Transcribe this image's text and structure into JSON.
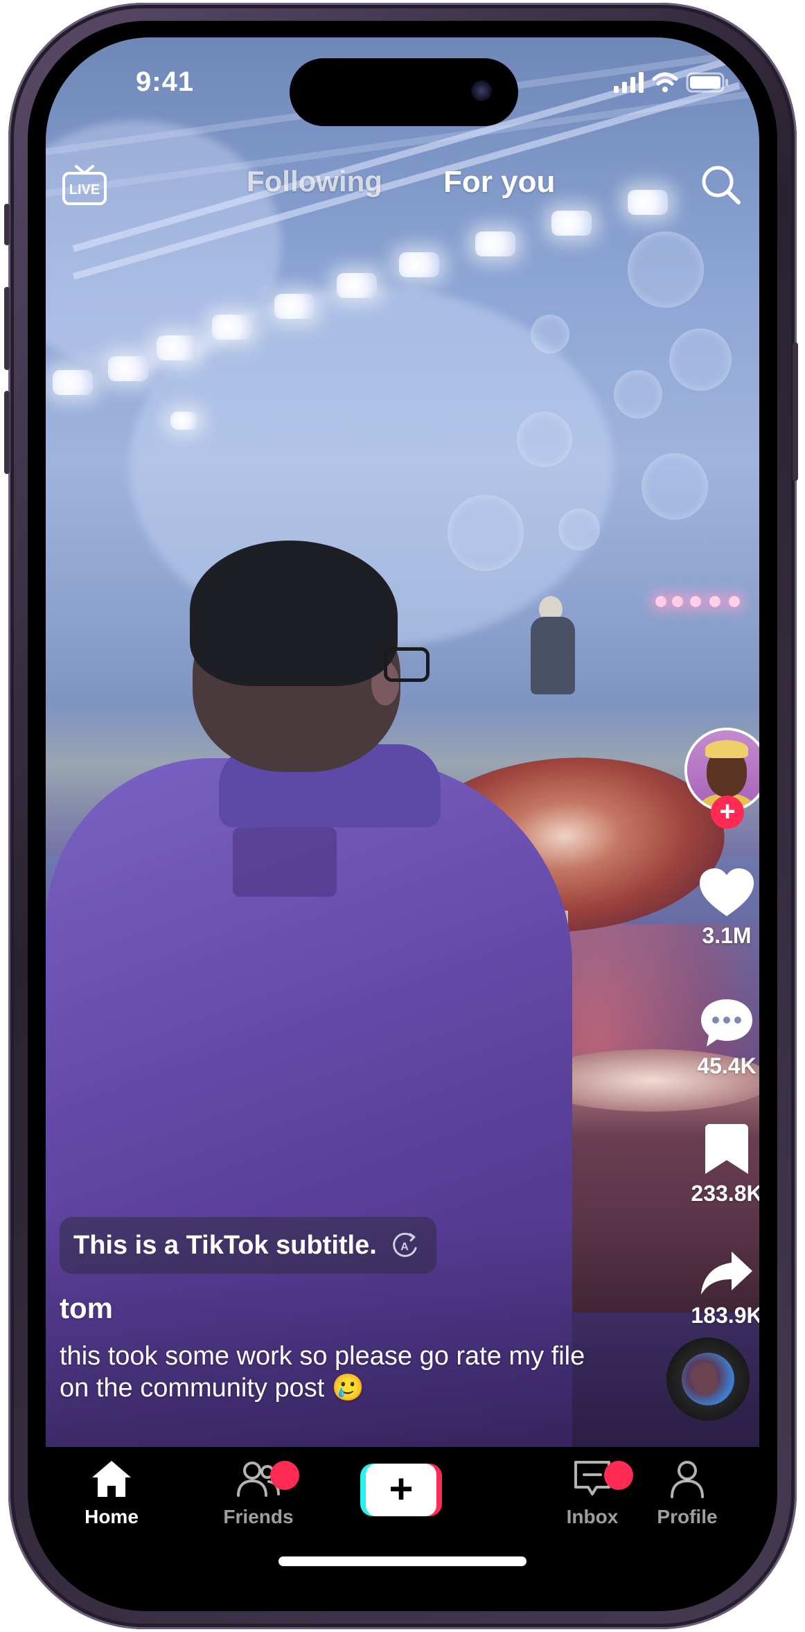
{
  "status_bar": {
    "time": "9:41"
  },
  "top_nav": {
    "live_label": "LIVE",
    "tabs": [
      {
        "label": "Following",
        "active": false
      },
      {
        "label": "For you",
        "active": true
      }
    ]
  },
  "rail": {
    "likes": "3.1M",
    "comments": "45.4K",
    "saves": "233.8K",
    "shares": "183.9K"
  },
  "video": {
    "subtitle": "This is a TikTok subtitle.",
    "username": "tom",
    "caption": "this took some work so please go rate my file on the community post 🥲"
  },
  "tabbar": {
    "items": [
      {
        "label": "Home",
        "active": true,
        "badge": false
      },
      {
        "label": "Friends",
        "active": false,
        "badge": true
      },
      {
        "label": "+",
        "active": false,
        "badge": false
      },
      {
        "label": "Inbox",
        "active": false,
        "badge": true
      },
      {
        "label": "Profile",
        "active": false,
        "badge": false
      }
    ]
  },
  "colors": {
    "accent_red": "#fe2c55",
    "accent_cyan": "#25f4ee",
    "badge": "#ff2b55"
  },
  "icons": [
    "live-icon",
    "search-icon",
    "heart-icon",
    "comment-icon",
    "bookmark-icon",
    "share-icon",
    "translate-icon",
    "home-icon",
    "friends-icon",
    "create-icon",
    "inbox-icon",
    "profile-icon"
  ]
}
